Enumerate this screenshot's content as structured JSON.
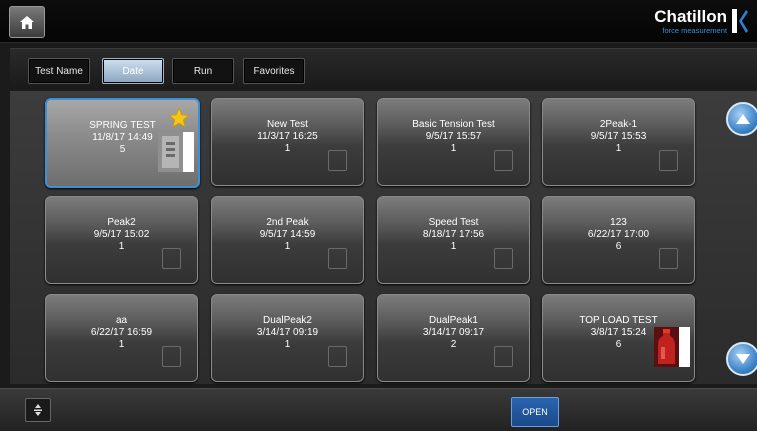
{
  "brand": {
    "name": "Chatillon",
    "tagline": "force measurement"
  },
  "sort_tabs": [
    {
      "label": "Test Name",
      "active": false
    },
    {
      "label": "Date",
      "active": true
    },
    {
      "label": "Run",
      "active": false
    },
    {
      "label": "Favorites",
      "active": false
    }
  ],
  "tests": [
    {
      "name": "SPRING TEST",
      "date": "11/8/17 14:49",
      "runs": "5",
      "favorite": true,
      "selected": true,
      "thumbnail": "spring-fixture"
    },
    {
      "name": "New Test",
      "date": "11/3/17 16:25",
      "runs": "1",
      "favorite": false
    },
    {
      "name": "Basic Tension Test",
      "date": "9/5/17 15:57",
      "runs": "1",
      "favorite": false
    },
    {
      "name": "2Peak-1",
      "date": "9/5/17 15:53",
      "runs": "1",
      "favorite": false
    },
    {
      "name": "Peak2",
      "date": "9/5/17 15:02",
      "runs": "1",
      "favorite": false
    },
    {
      "name": "2nd Peak",
      "date": "9/5/17 14:59",
      "runs": "1",
      "favorite": false
    },
    {
      "name": "Speed Test",
      "date": "8/18/17 17:56",
      "runs": "1",
      "favorite": false
    },
    {
      "name": "123",
      "date": "6/22/17 17:00",
      "runs": "6",
      "favorite": false
    },
    {
      "name": "aa",
      "date": "6/22/17 16:59",
      "runs": "1",
      "favorite": false
    },
    {
      "name": "DualPeak2",
      "date": "3/14/17 09:19",
      "runs": "1",
      "favorite": false
    },
    {
      "name": "DualPeak1",
      "date": "3/14/17 09:17",
      "runs": "2",
      "favorite": false
    },
    {
      "name": "TOP LOAD TEST",
      "date": "3/8/17 15:24",
      "runs": "6",
      "favorite": false,
      "thumbnail": "red-bottle"
    }
  ],
  "actions": {
    "open_label": "OPEN"
  },
  "colors": {
    "accent": "#3f8fd8",
    "favorite_star": "#f5c518",
    "open_button": "#2a64b0"
  },
  "icons": {
    "home": "home-icon",
    "scroll_up": "up-arrow-icon",
    "scroll_down": "down-arrow-icon",
    "sort_direction": "sort-direction-icon"
  }
}
